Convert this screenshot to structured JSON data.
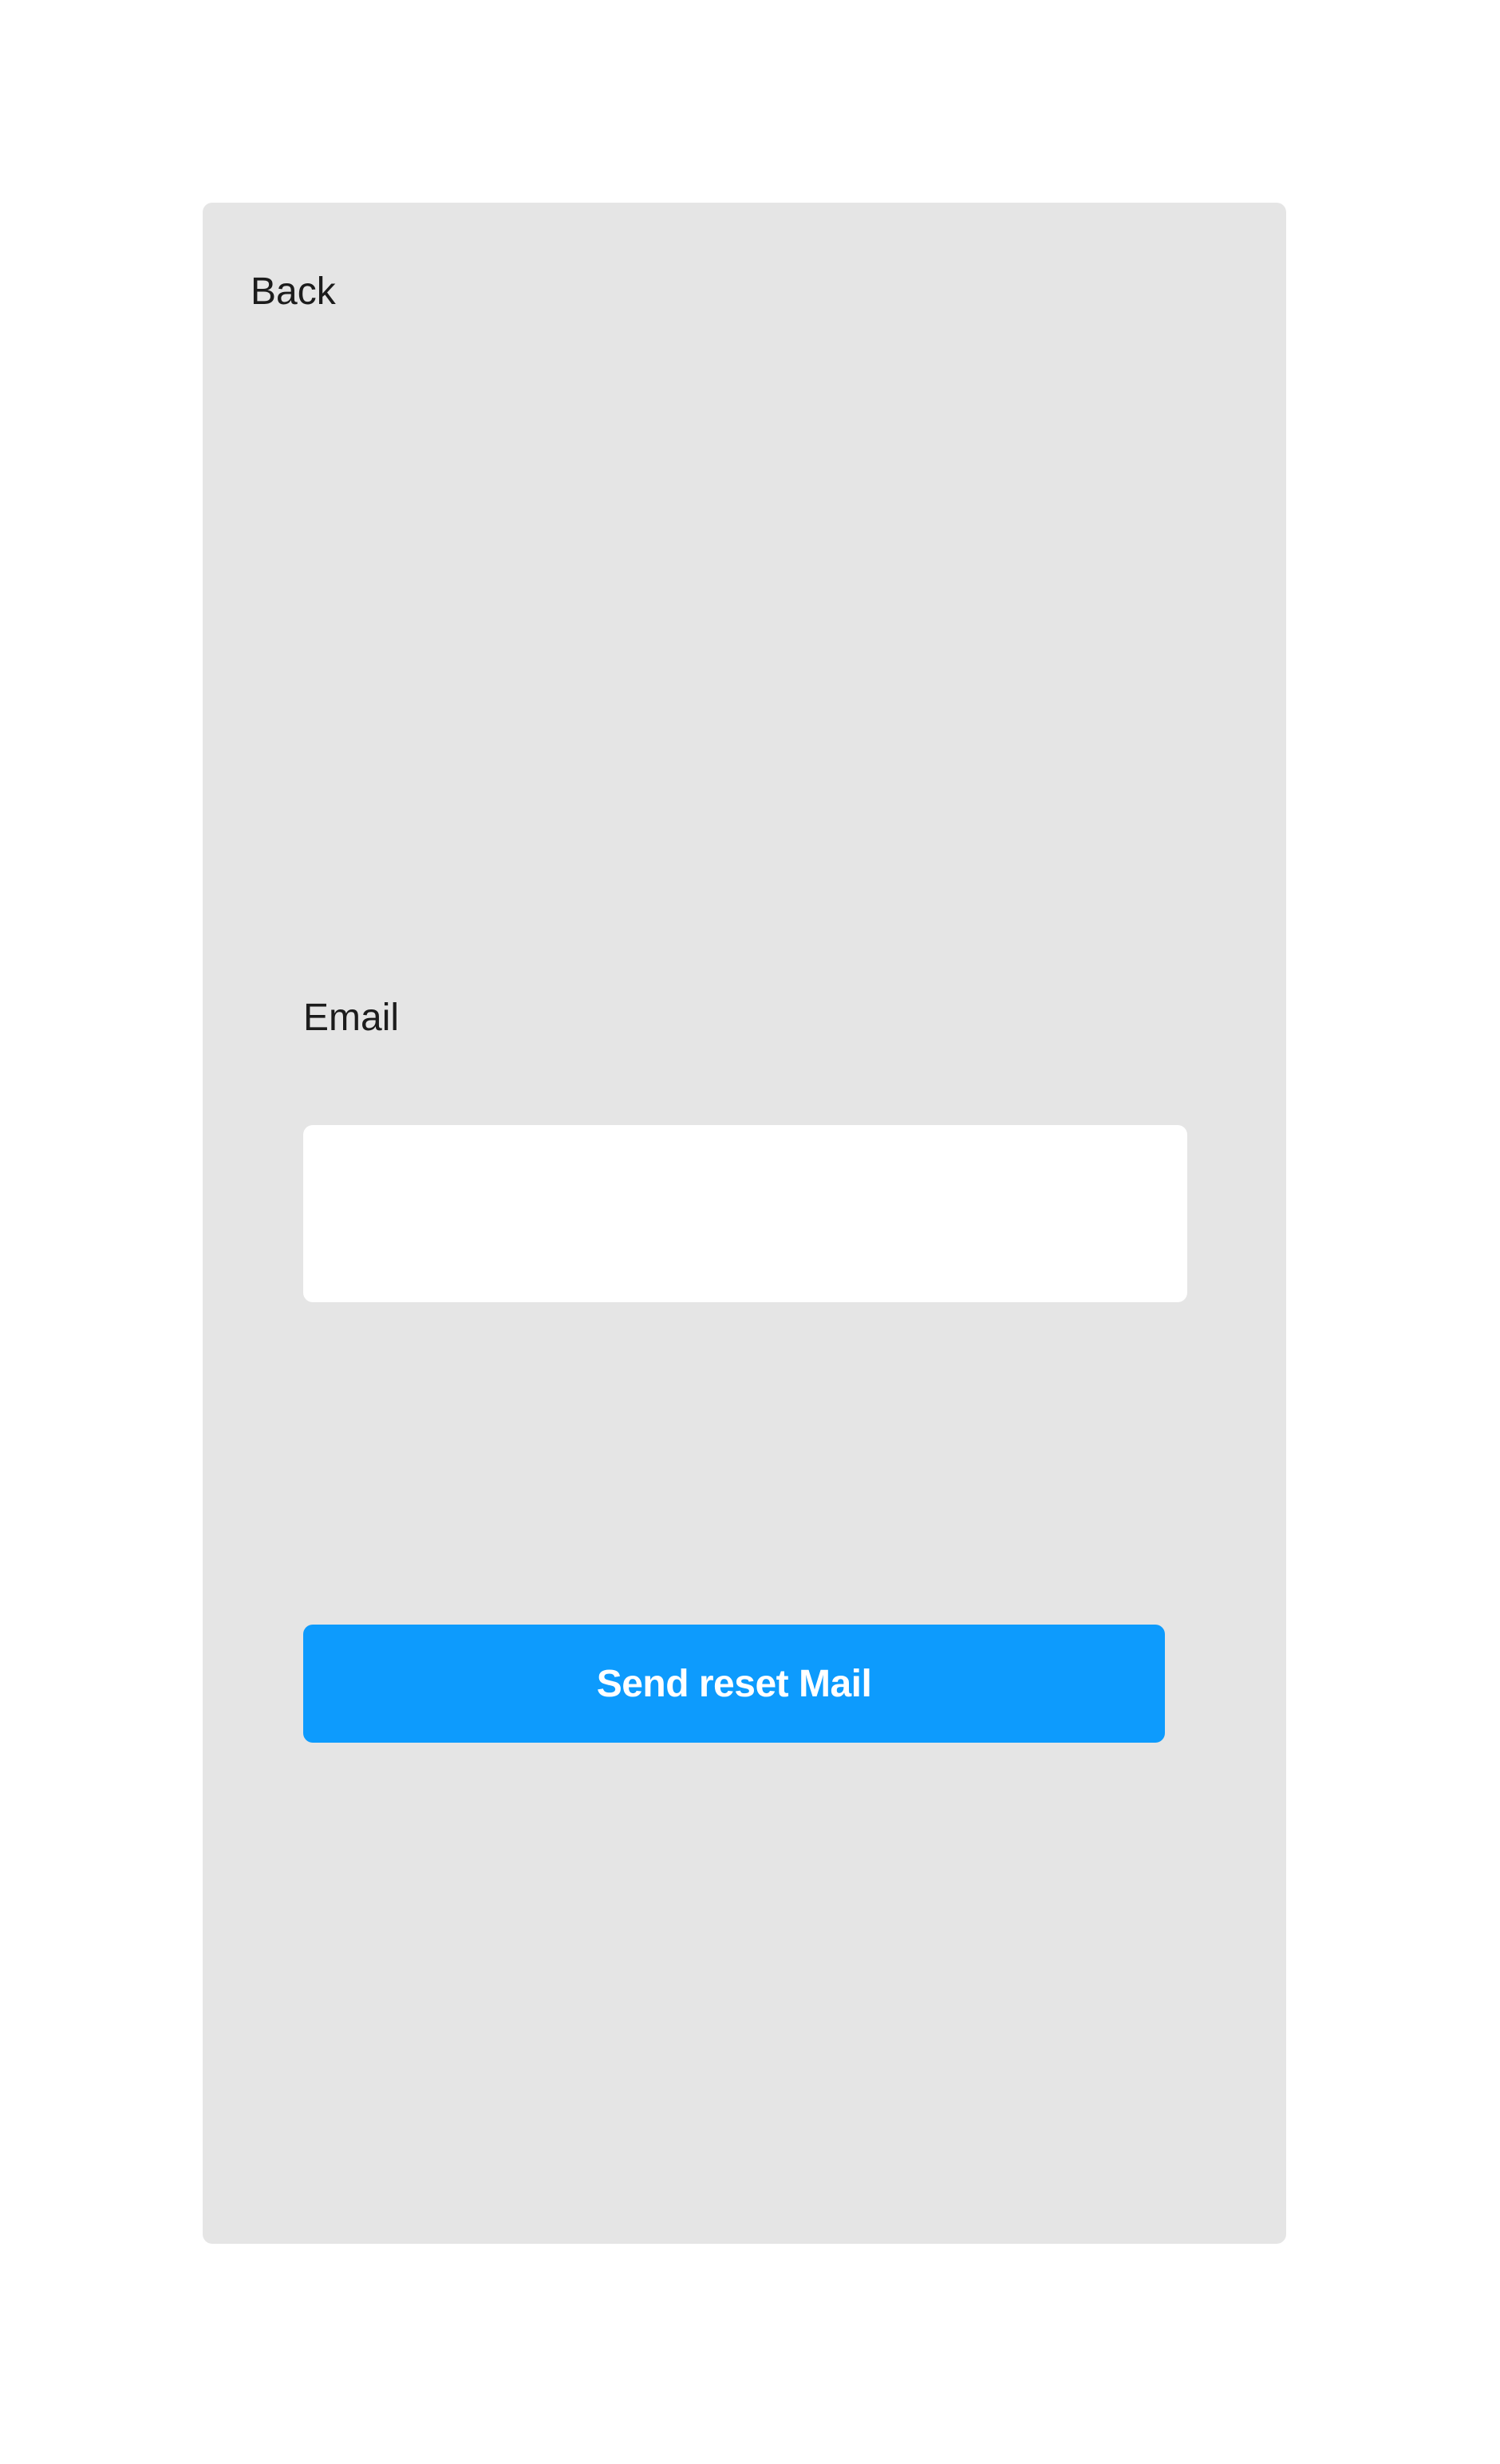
{
  "nav": {
    "back_label": "Back"
  },
  "form": {
    "email_label": "Email",
    "email_value": "",
    "email_placeholder": "",
    "submit_label": "Send reset Mail"
  },
  "colors": {
    "card_background": "#e5e5e5",
    "input_background": "#ffffff",
    "button_background": "#0d9bfd",
    "button_text": "#ffffff",
    "text": "#1c1c1c"
  }
}
